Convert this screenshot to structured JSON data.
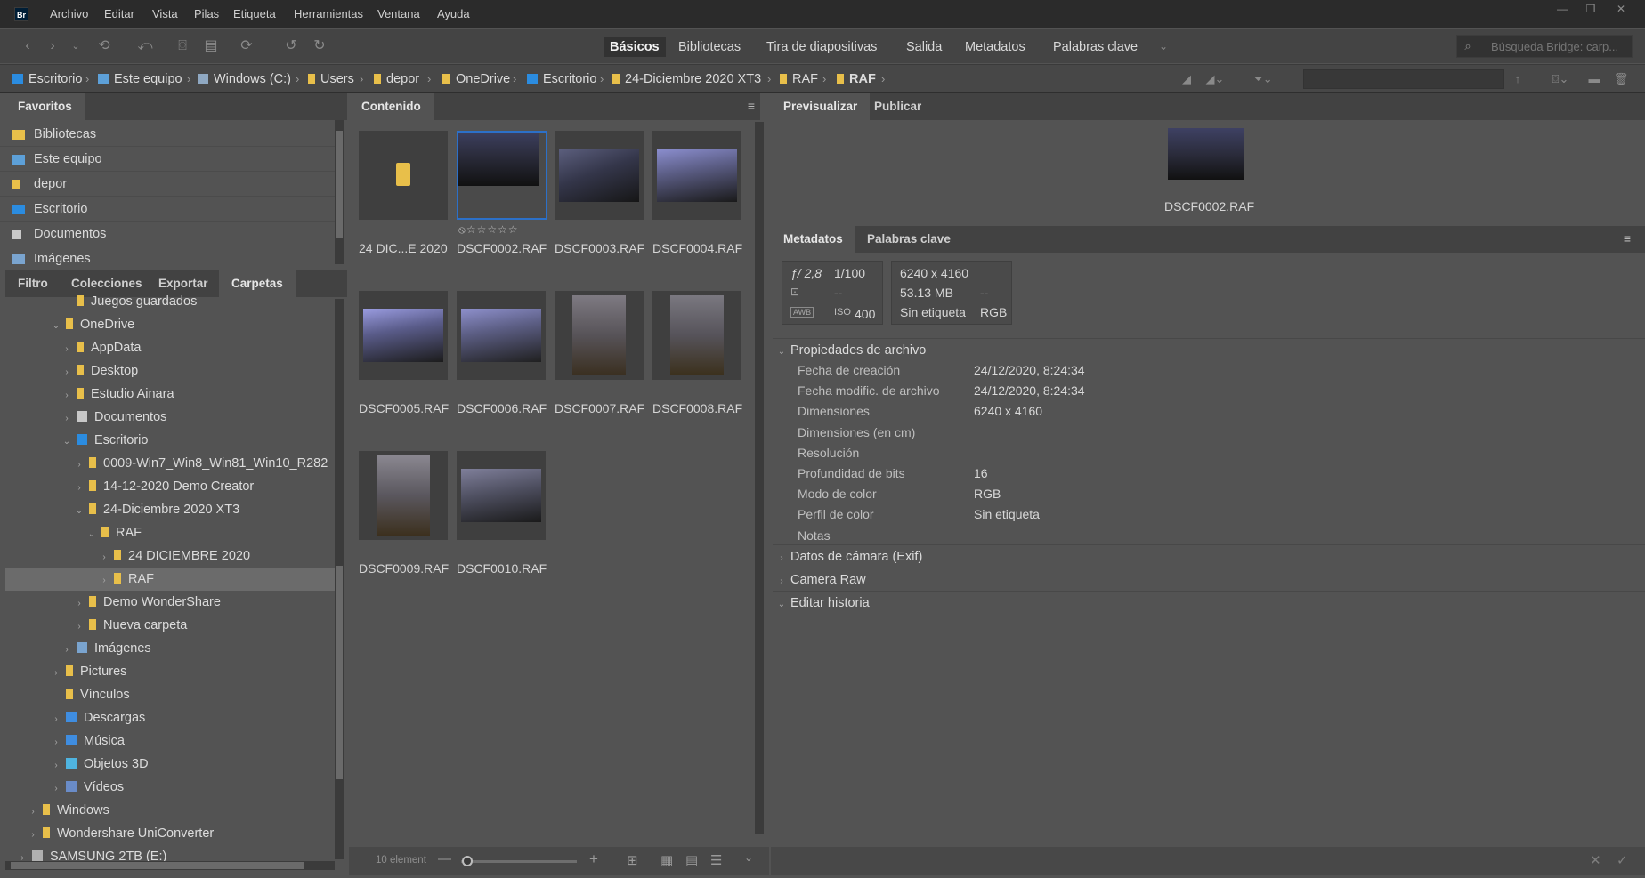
{
  "app": {
    "logo": "Br"
  },
  "menu": [
    "Archivo",
    "Editar",
    "Vista",
    "Pilas",
    "Etiqueta",
    "Herramientas",
    "Ventana",
    "Ayuda"
  ],
  "workspaces": [
    "Básicos",
    "Bibliotecas",
    "Tira de diapositivas",
    "Salida",
    "Metadatos",
    "Palabras clave"
  ],
  "search": {
    "placeholder": "Búsqueda Bridge: carp..."
  },
  "breadcrumb": [
    "Escritorio",
    "Este equipo",
    "Windows (C:)",
    "Users",
    "depor",
    "OneDrive",
    "Escritorio",
    "24-Diciembre 2020 XT3",
    "RAF",
    "RAF"
  ],
  "favorites": {
    "tab": "Favoritos",
    "items": [
      "Bibliotecas",
      "Este equipo",
      "depor",
      "Escritorio",
      "Documentos",
      "Imágenes"
    ]
  },
  "lower_tabs": [
    "Filtro",
    "Colecciones",
    "Exportar",
    "Carpetas"
  ],
  "folders": [
    {
      "label": "Juegos guardados",
      "expand": ""
    },
    {
      "label": "OneDrive",
      "expand": "⌄"
    },
    {
      "label": "AppData",
      "expand": "›"
    },
    {
      "label": "Desktop",
      "expand": "›"
    },
    {
      "label": "Estudio Ainara",
      "expand": "›"
    },
    {
      "label": "Documentos",
      "expand": "›"
    },
    {
      "label": "Escritorio",
      "expand": "⌄"
    },
    {
      "label": "0009-Win7_Win8_Win81_Win10_R282",
      "expand": "›"
    },
    {
      "label": "14-12-2020 Demo Creator",
      "expand": "›"
    },
    {
      "label": "24-Diciembre 2020 XT3",
      "expand": "⌄"
    },
    {
      "label": "RAF",
      "expand": "⌄"
    },
    {
      "label": "24 DICIEMBRE 2020",
      "expand": "›"
    },
    {
      "label": "RAF",
      "expand": "›"
    },
    {
      "label": "Demo  WonderShare",
      "expand": "›"
    },
    {
      "label": "Nueva carpeta",
      "expand": "›"
    },
    {
      "label": "Imágenes",
      "expand": "›"
    },
    {
      "label": "Pictures",
      "expand": "›"
    },
    {
      "label": "Vínculos",
      "expand": ""
    },
    {
      "label": "Descargas",
      "expand": "›"
    },
    {
      "label": "Música",
      "expand": "›"
    },
    {
      "label": "Objetos 3D",
      "expand": "›"
    },
    {
      "label": "Vídeos",
      "expand": "›"
    },
    {
      "label": "Windows",
      "expand": "›"
    },
    {
      "label": "Wondershare UniConverter",
      "expand": "›"
    },
    {
      "label": "SAMSUNG 2TB (E:)",
      "expand": "›"
    }
  ],
  "content": {
    "tab": "Contenido",
    "items": [
      "24 DIC...E 2020",
      "DSCF0002.RAF",
      "DSCF0003.RAF",
      "DSCF0004.RAF",
      "DSCF0005.RAF",
      "DSCF0006.RAF",
      "DSCF0007.RAF",
      "DSCF0008.RAF",
      "DSCF0009.RAF",
      "DSCF0010.RAF"
    ],
    "count": "10 element",
    "rating_placeholder": "⦸☆☆☆☆☆"
  },
  "preview": {
    "tabs": [
      "Previsualizar",
      "Publicar"
    ],
    "filename": "DSCF0002.RAF"
  },
  "metadata": {
    "tabs": [
      "Metadatos",
      "Palabras clave"
    ],
    "header": {
      "aperture": "ƒ/ 2,8",
      "shutter": "1/100",
      "ev": "--",
      "wb": "AWB",
      "iso": "400",
      "iso_label": "ISO",
      "dimensions": "6240 x 4160",
      "size": "53.13 MB",
      "size_extra": "--",
      "label": "Sin etiqueta",
      "mode": "RGB"
    },
    "sections": {
      "file_props": "Propiedades de archivo",
      "exif": "Datos de cámara (Exif)",
      "raw": "Camera Raw",
      "history": "Editar historia"
    },
    "rows": [
      {
        "label": "Fecha de creación",
        "value": "24/12/2020, 8:24:34"
      },
      {
        "label": "Fecha modific. de archivo",
        "value": "24/12/2020, 8:24:34"
      },
      {
        "label": "Dimensiones",
        "value": "6240 x 4160"
      },
      {
        "label": "Dimensiones (en cm)",
        "value": ""
      },
      {
        "label": "Resolución",
        "value": ""
      },
      {
        "label": "Profundidad de bits",
        "value": "16"
      },
      {
        "label": "Modo de color",
        "value": "RGB"
      },
      {
        "label": "Perfil de color",
        "value": "Sin etiqueta"
      },
      {
        "label": "Notas",
        "value": ""
      }
    ]
  },
  "colors": {
    "accent": "#2c70c8",
    "folder": "#e8bf4a",
    "background": "#535353"
  }
}
